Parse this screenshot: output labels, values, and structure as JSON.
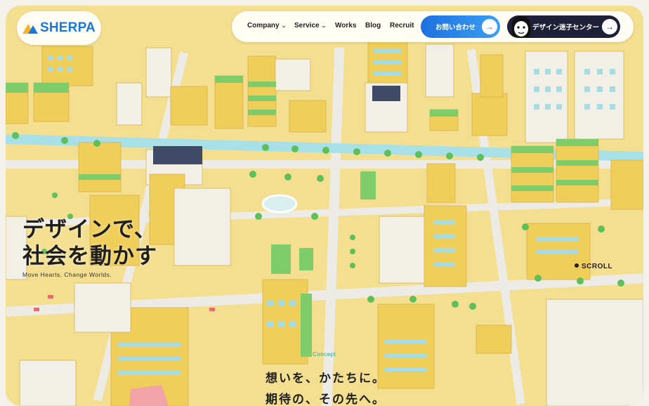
{
  "brand": {
    "name": "SHERPA",
    "color": "#1a78d6"
  },
  "nav": {
    "items": [
      {
        "label": "Company",
        "has_dropdown": true
      },
      {
        "label": "Service",
        "has_dropdown": true
      },
      {
        "label": "Works",
        "has_dropdown": false
      },
      {
        "label": "Blog",
        "has_dropdown": false
      },
      {
        "label": "Recruit",
        "has_dropdown": false
      }
    ],
    "contact_label": "お問い合わせ",
    "center_label": "デザイン迷子センター",
    "arrow": "→"
  },
  "hero": {
    "line1": "デザインで、",
    "line2": "社会を動かす",
    "subtitle": "Move Hearts. Change Worlds."
  },
  "scroll_label": "SCROLL",
  "concept": {
    "label": "Concept",
    "line1": "想いを、かたちに。",
    "line2": "期待の、その先へ。"
  },
  "colors": {
    "ground": "#f4df90",
    "road": "#e9e9e6",
    "river": "#a8e0e8",
    "accent": "#1f6fe0",
    "dark": "#1d2036"
  }
}
